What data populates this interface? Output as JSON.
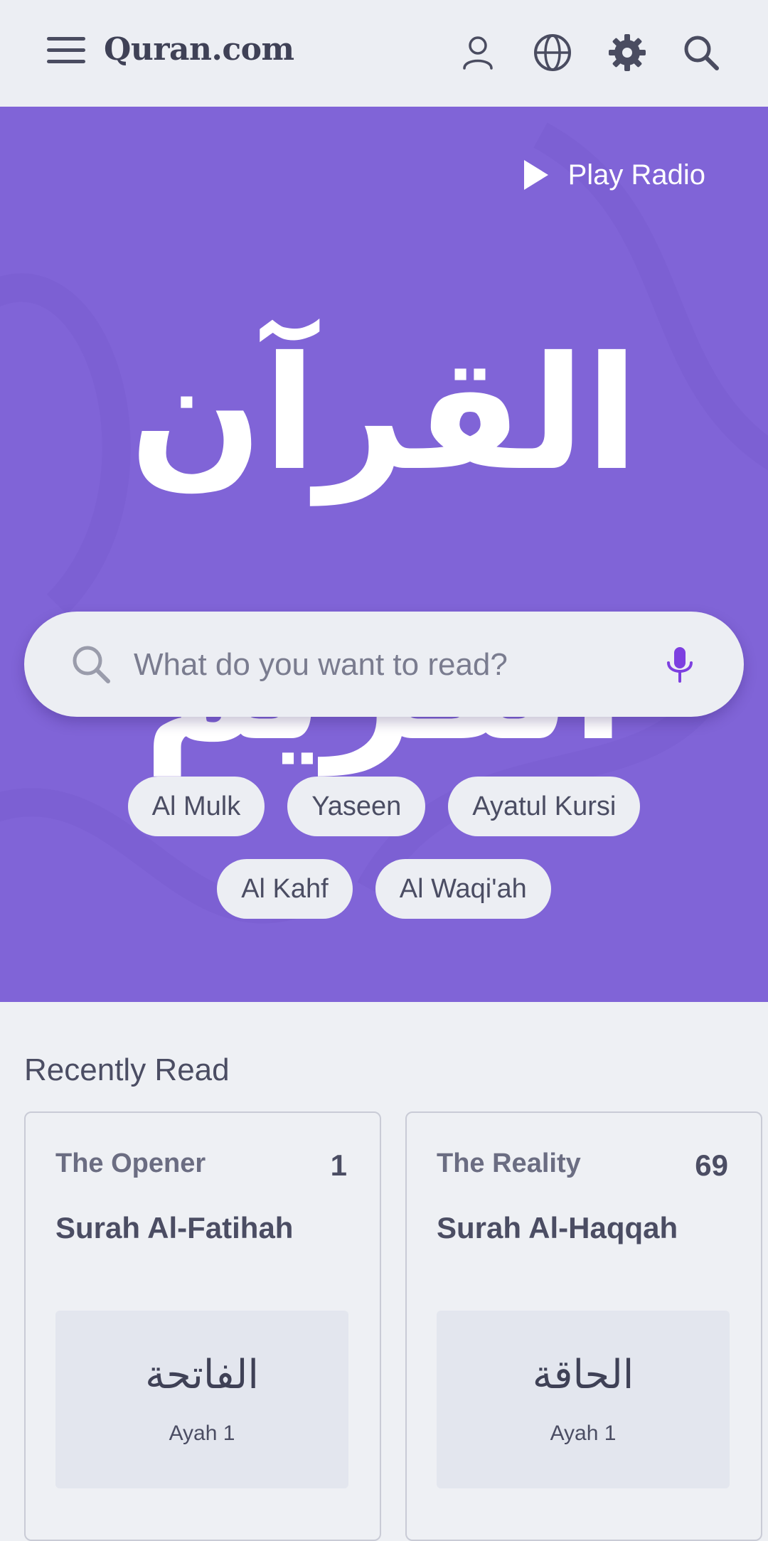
{
  "header": {
    "logo": "Quran.com",
    "icons": [
      "menu-icon",
      "user-icon",
      "globe-icon",
      "gear-icon",
      "search-icon"
    ]
  },
  "hero": {
    "background_color": "#8064d7",
    "play_radio_label": "Play Radio",
    "calligraphy_text": "القرآن الكريم",
    "search": {
      "placeholder": "What do you want to read?"
    },
    "quick_links": [
      "Al Mulk",
      "Yaseen",
      "Ayatul Kursi",
      "Al Kahf",
      "Al Waqi'ah"
    ]
  },
  "recently_read": {
    "title": "Recently Read",
    "cards": [
      {
        "translated_name": "The Opener",
        "number": "1",
        "title": "Surah Al-Fatihah",
        "arabic_name": "الفاتحة",
        "ayah": "Ayah 1"
      },
      {
        "translated_name": "The Reality",
        "number": "69",
        "title": "Surah Al-Haqqah",
        "arabic_name": "الحاقة",
        "ayah": "Ayah 1"
      }
    ]
  }
}
